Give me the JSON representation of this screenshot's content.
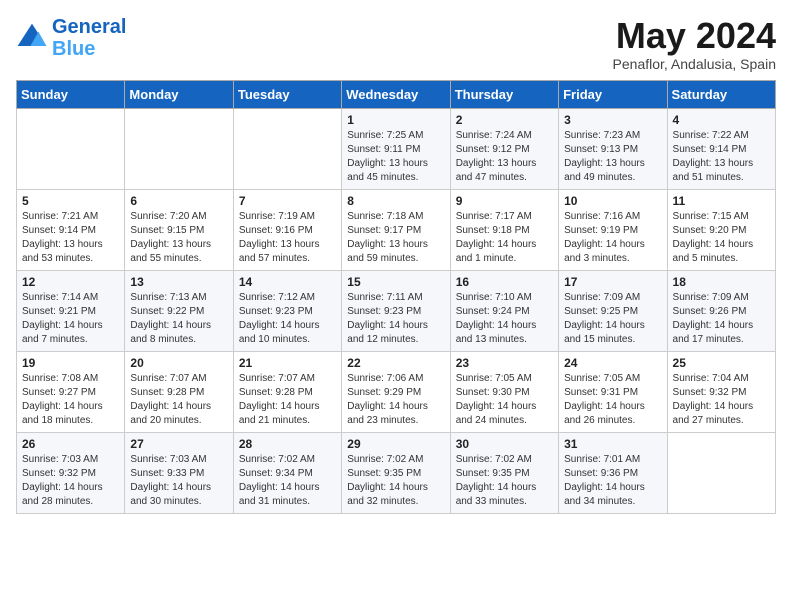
{
  "header": {
    "logo_line1": "General",
    "logo_line2": "Blue",
    "title": "May 2024",
    "subtitle": "Penaflor, Andalusia, Spain"
  },
  "days_of_week": [
    "Sunday",
    "Monday",
    "Tuesday",
    "Wednesday",
    "Thursday",
    "Friday",
    "Saturday"
  ],
  "weeks": [
    [
      {
        "day": "",
        "content": ""
      },
      {
        "day": "",
        "content": ""
      },
      {
        "day": "",
        "content": ""
      },
      {
        "day": "1",
        "content": "Sunrise: 7:25 AM\nSunset: 9:11 PM\nDaylight: 13 hours\nand 45 minutes."
      },
      {
        "day": "2",
        "content": "Sunrise: 7:24 AM\nSunset: 9:12 PM\nDaylight: 13 hours\nand 47 minutes."
      },
      {
        "day": "3",
        "content": "Sunrise: 7:23 AM\nSunset: 9:13 PM\nDaylight: 13 hours\nand 49 minutes."
      },
      {
        "day": "4",
        "content": "Sunrise: 7:22 AM\nSunset: 9:14 PM\nDaylight: 13 hours\nand 51 minutes."
      }
    ],
    [
      {
        "day": "5",
        "content": "Sunrise: 7:21 AM\nSunset: 9:14 PM\nDaylight: 13 hours\nand 53 minutes."
      },
      {
        "day": "6",
        "content": "Sunrise: 7:20 AM\nSunset: 9:15 PM\nDaylight: 13 hours\nand 55 minutes."
      },
      {
        "day": "7",
        "content": "Sunrise: 7:19 AM\nSunset: 9:16 PM\nDaylight: 13 hours\nand 57 minutes."
      },
      {
        "day": "8",
        "content": "Sunrise: 7:18 AM\nSunset: 9:17 PM\nDaylight: 13 hours\nand 59 minutes."
      },
      {
        "day": "9",
        "content": "Sunrise: 7:17 AM\nSunset: 9:18 PM\nDaylight: 14 hours\nand 1 minute."
      },
      {
        "day": "10",
        "content": "Sunrise: 7:16 AM\nSunset: 9:19 PM\nDaylight: 14 hours\nand 3 minutes."
      },
      {
        "day": "11",
        "content": "Sunrise: 7:15 AM\nSunset: 9:20 PM\nDaylight: 14 hours\nand 5 minutes."
      }
    ],
    [
      {
        "day": "12",
        "content": "Sunrise: 7:14 AM\nSunset: 9:21 PM\nDaylight: 14 hours\nand 7 minutes."
      },
      {
        "day": "13",
        "content": "Sunrise: 7:13 AM\nSunset: 9:22 PM\nDaylight: 14 hours\nand 8 minutes."
      },
      {
        "day": "14",
        "content": "Sunrise: 7:12 AM\nSunset: 9:23 PM\nDaylight: 14 hours\nand 10 minutes."
      },
      {
        "day": "15",
        "content": "Sunrise: 7:11 AM\nSunset: 9:23 PM\nDaylight: 14 hours\nand 12 minutes."
      },
      {
        "day": "16",
        "content": "Sunrise: 7:10 AM\nSunset: 9:24 PM\nDaylight: 14 hours\nand 13 minutes."
      },
      {
        "day": "17",
        "content": "Sunrise: 7:09 AM\nSunset: 9:25 PM\nDaylight: 14 hours\nand 15 minutes."
      },
      {
        "day": "18",
        "content": "Sunrise: 7:09 AM\nSunset: 9:26 PM\nDaylight: 14 hours\nand 17 minutes."
      }
    ],
    [
      {
        "day": "19",
        "content": "Sunrise: 7:08 AM\nSunset: 9:27 PM\nDaylight: 14 hours\nand 18 minutes."
      },
      {
        "day": "20",
        "content": "Sunrise: 7:07 AM\nSunset: 9:28 PM\nDaylight: 14 hours\nand 20 minutes."
      },
      {
        "day": "21",
        "content": "Sunrise: 7:07 AM\nSunset: 9:28 PM\nDaylight: 14 hours\nand 21 minutes."
      },
      {
        "day": "22",
        "content": "Sunrise: 7:06 AM\nSunset: 9:29 PM\nDaylight: 14 hours\nand 23 minutes."
      },
      {
        "day": "23",
        "content": "Sunrise: 7:05 AM\nSunset: 9:30 PM\nDaylight: 14 hours\nand 24 minutes."
      },
      {
        "day": "24",
        "content": "Sunrise: 7:05 AM\nSunset: 9:31 PM\nDaylight: 14 hours\nand 26 minutes."
      },
      {
        "day": "25",
        "content": "Sunrise: 7:04 AM\nSunset: 9:32 PM\nDaylight: 14 hours\nand 27 minutes."
      }
    ],
    [
      {
        "day": "26",
        "content": "Sunrise: 7:03 AM\nSunset: 9:32 PM\nDaylight: 14 hours\nand 28 minutes."
      },
      {
        "day": "27",
        "content": "Sunrise: 7:03 AM\nSunset: 9:33 PM\nDaylight: 14 hours\nand 30 minutes."
      },
      {
        "day": "28",
        "content": "Sunrise: 7:02 AM\nSunset: 9:34 PM\nDaylight: 14 hours\nand 31 minutes."
      },
      {
        "day": "29",
        "content": "Sunrise: 7:02 AM\nSunset: 9:35 PM\nDaylight: 14 hours\nand 32 minutes."
      },
      {
        "day": "30",
        "content": "Sunrise: 7:02 AM\nSunset: 9:35 PM\nDaylight: 14 hours\nand 33 minutes."
      },
      {
        "day": "31",
        "content": "Sunrise: 7:01 AM\nSunset: 9:36 PM\nDaylight: 14 hours\nand 34 minutes."
      },
      {
        "day": "",
        "content": ""
      }
    ]
  ]
}
